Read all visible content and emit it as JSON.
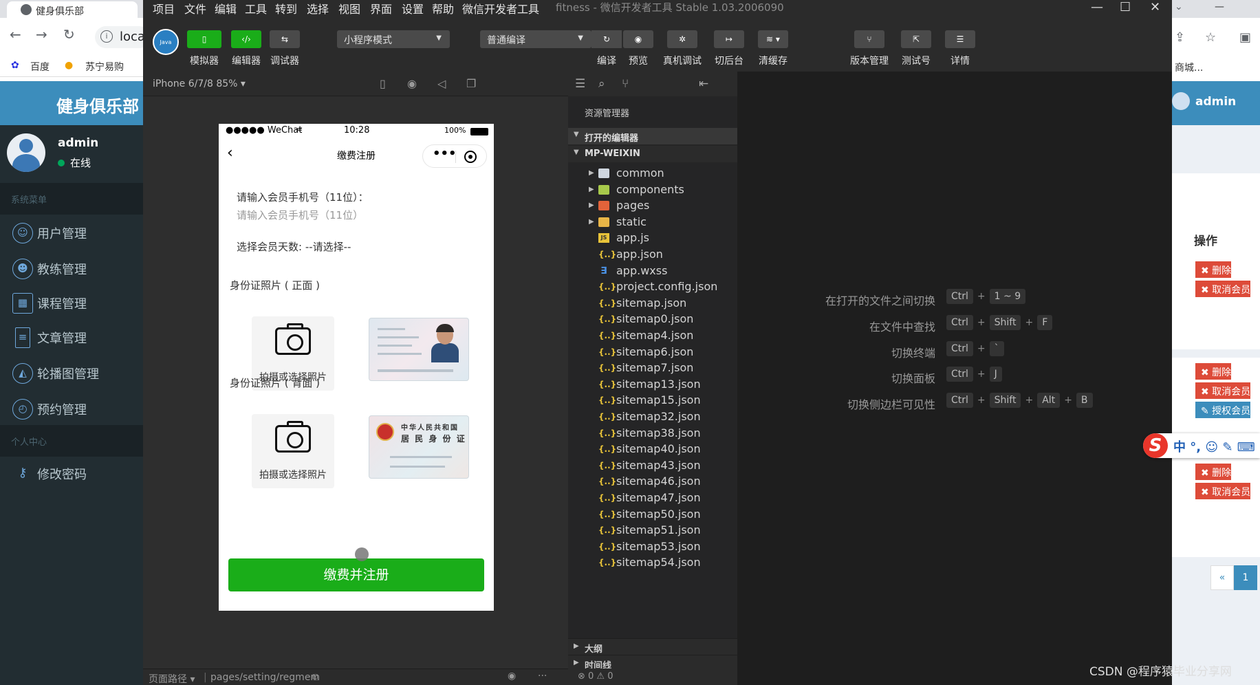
{
  "browser_left": {
    "tab_title": "健身俱乐部",
    "url_text": "loca",
    "bookmarks": [
      "百度",
      "苏宁易购"
    ],
    "site_title": "健身俱乐部",
    "user": {
      "name": "admin",
      "status": "在线"
    },
    "section_system": "系统菜单",
    "menu": [
      "用户管理",
      "教练管理",
      "课程管理",
      "文章管理",
      "轮播图管理",
      "预约管理"
    ],
    "section_personal": "个人中心",
    "change_password": "修改密码"
  },
  "browser_right": {
    "bookmark_text": "商城...",
    "user_name": "admin",
    "column_op": "操作",
    "btn_delete": "✖ 删除",
    "btn_cancel_member": "✖ 取消会员",
    "btn_authorize": "✎ 授权会员",
    "page_prev": "«",
    "page_current": "1"
  },
  "devtools": {
    "menu": [
      "项目",
      "文件",
      "编辑",
      "工具",
      "转到",
      "选择",
      "视图",
      "界面",
      "设置",
      "帮助",
      "微信开发者工具"
    ],
    "window_title": "fitness - 微信开发者工具 Stable 1.03.2006090",
    "window_controls": [
      "—",
      "☐",
      "✕"
    ],
    "toolbar": {
      "logo_text": "Java",
      "simulator": "模拟器",
      "editor": "编辑器",
      "debugger": "调试器",
      "mode_select": "小程序模式",
      "compile_select": "普通编译",
      "compile": "编译",
      "preview": "预览",
      "remote_debug": "真机调试",
      "background": "切后台",
      "clear_cache": "清缓存",
      "version": "版本管理",
      "test_account": "测试号",
      "details": "详情"
    },
    "simulator": {
      "device": "iPhone 6/7/8 85% ▾",
      "footer_path_label": "页面路径 ▾",
      "footer_path": "pages/setting/regmem"
    },
    "phone": {
      "carrier": "●●●●● WeChat",
      "time": "10:28",
      "battery": "100%",
      "nav_title": "缴费注册",
      "phone_label": "请输入会员手机号（11位）：",
      "phone_placeholder": "请输入会员手机号（11位）",
      "days_label": "选择会员天数: --请选择--",
      "id_front_label": "身份证照片 ( 正面 )",
      "id_back_label": "身份证照片 ( 背面 )",
      "upload_label": "拍摄或选择照片",
      "card_back_title_1": "中华人民共和国",
      "card_back_title_2": "居 民 身 份 证",
      "submit": "缴费并注册"
    },
    "explorer": {
      "title": "资源管理器",
      "open_editors": "打开的编辑器",
      "project": "MP-WEIXIN",
      "folders": [
        {
          "name": "common",
          "type": "folder"
        },
        {
          "name": "components",
          "type": "folder-green"
        },
        {
          "name": "pages",
          "type": "folder-red"
        },
        {
          "name": "static",
          "type": "folder-yellow"
        }
      ],
      "files": [
        {
          "name": "app.js",
          "type": "js"
        },
        {
          "name": "app.json",
          "type": "json"
        },
        {
          "name": "app.wxss",
          "type": "wxss"
        },
        {
          "name": "project.config.json",
          "type": "json"
        },
        {
          "name": "sitemap.json",
          "type": "json"
        },
        {
          "name": "sitemap0.json",
          "type": "json"
        },
        {
          "name": "sitemap4.json",
          "type": "json"
        },
        {
          "name": "sitemap6.json",
          "type": "json"
        },
        {
          "name": "sitemap7.json",
          "type": "json"
        },
        {
          "name": "sitemap13.json",
          "type": "json"
        },
        {
          "name": "sitemap15.json",
          "type": "json"
        },
        {
          "name": "sitemap32.json",
          "type": "json"
        },
        {
          "name": "sitemap38.json",
          "type": "json"
        },
        {
          "name": "sitemap40.json",
          "type": "json"
        },
        {
          "name": "sitemap43.json",
          "type": "json"
        },
        {
          "name": "sitemap46.json",
          "type": "json"
        },
        {
          "name": "sitemap47.json",
          "type": "json"
        },
        {
          "name": "sitemap50.json",
          "type": "json"
        },
        {
          "name": "sitemap51.json",
          "type": "json"
        },
        {
          "name": "sitemap53.json",
          "type": "json"
        },
        {
          "name": "sitemap54.json",
          "type": "json"
        }
      ],
      "outline": "大纲",
      "timeline": "时间线",
      "status": "⊗ 0 ⚠ 0"
    },
    "shortcuts": [
      {
        "label": "在打开的文件之间切换",
        "keys": [
          "Ctrl",
          "1 ~ 9"
        ]
      },
      {
        "label": "在文件中查找",
        "keys": [
          "Ctrl",
          "Shift",
          "F"
        ]
      },
      {
        "label": "切换终端",
        "keys": [
          "Ctrl",
          "`"
        ]
      },
      {
        "label": "切换面板",
        "keys": [
          "Ctrl",
          "J"
        ]
      },
      {
        "label": "切换侧边栏可见性",
        "keys": [
          "Ctrl",
          "Shift",
          "Alt",
          "B"
        ]
      }
    ]
  },
  "ime": {
    "text": "中 °, ☺ ✎ ⌨"
  },
  "watermark": "CSDN @程序猿毕业分享网",
  "colors": {
    "accent_green": "#1aad19",
    "admin_blue": "#3c8dbc",
    "danger_red": "#dd4b39",
    "sidebar_dark": "#222d32"
  }
}
